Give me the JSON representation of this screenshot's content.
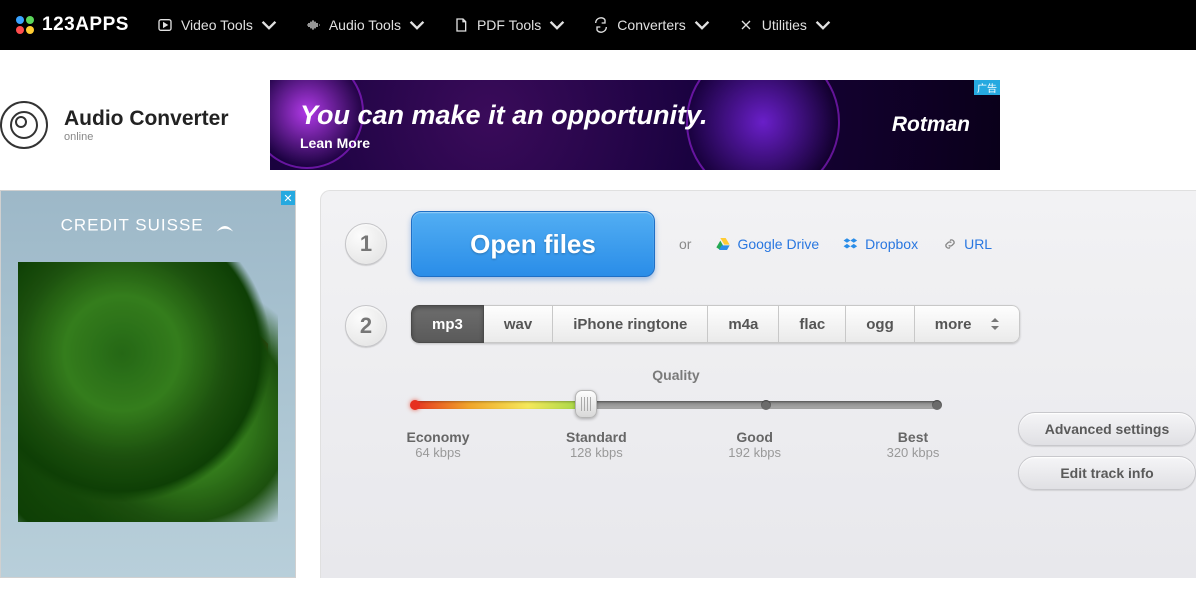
{
  "nav": {
    "brand": "123APPS",
    "items": [
      "Video Tools",
      "Audio Tools",
      "PDF Tools",
      "Converters",
      "Utilities"
    ]
  },
  "app": {
    "title": "Audio Converter",
    "subtitle": "online"
  },
  "ad_top": {
    "headline": "You can make it an opportunity.",
    "cta": "Lean More",
    "brand": "Rotman",
    "tag": "广告"
  },
  "ad_side": {
    "brand": "CREDIT SUISSE"
  },
  "step1": {
    "num": "1",
    "open": "Open files",
    "or": "or",
    "gdrive": "Google Drive",
    "dropbox": "Dropbox",
    "url": "URL"
  },
  "step2": {
    "num": "2",
    "formats": [
      "mp3",
      "wav",
      "iPhone ringtone",
      "m4a",
      "flac",
      "ogg",
      "more"
    ],
    "active": 0,
    "quality_label": "Quality",
    "levels": [
      {
        "name": "Economy",
        "kbps": "64 kbps"
      },
      {
        "name": "Standard",
        "kbps": "128 kbps"
      },
      {
        "name": "Good",
        "kbps": "192 kbps"
      },
      {
        "name": "Best",
        "kbps": "320 kbps"
      }
    ],
    "selected_level": 1,
    "advanced": "Advanced settings",
    "edit_track": "Edit track info"
  }
}
